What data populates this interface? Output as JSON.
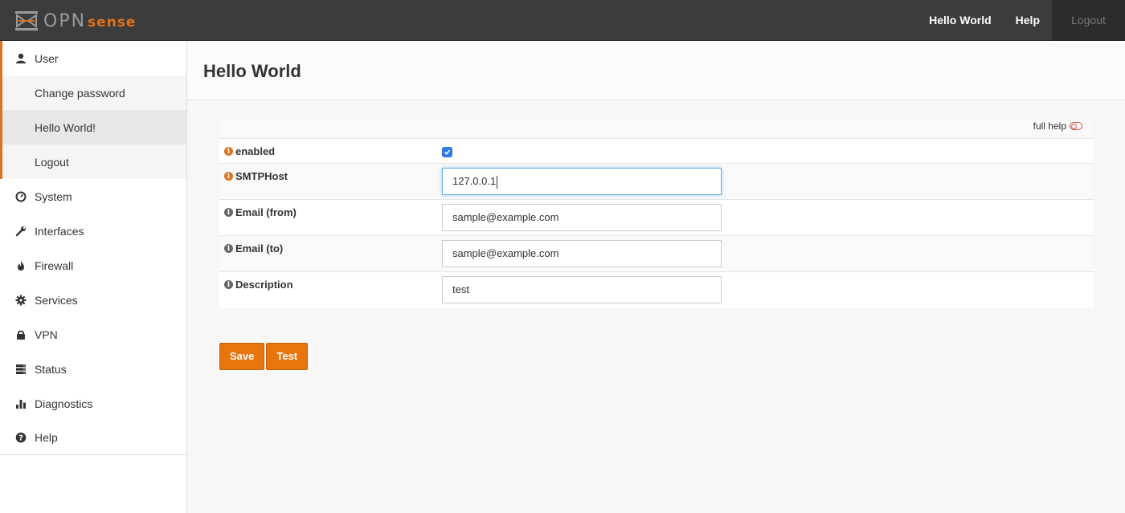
{
  "brand": {
    "name_part1": "OPN",
    "name_part2": "sense"
  },
  "topnav": {
    "item1": "Hello World",
    "item2": "Help",
    "item3": "Logout"
  },
  "sidebar": {
    "user": {
      "label": "User",
      "icon": "user-icon"
    },
    "submenu": [
      {
        "label": "Change password"
      },
      {
        "label": "Hello World!"
      },
      {
        "label": "Logout"
      }
    ],
    "items": [
      {
        "label": "System",
        "icon": "dashboard-icon"
      },
      {
        "label": "Interfaces",
        "icon": "wrench-icon"
      },
      {
        "label": "Firewall",
        "icon": "fire-icon"
      },
      {
        "label": "Services",
        "icon": "gear-icon"
      },
      {
        "label": "VPN",
        "icon": "lock-icon"
      },
      {
        "label": "Status",
        "icon": "server-icon"
      },
      {
        "label": "Diagnostics",
        "icon": "bar-chart-icon"
      },
      {
        "label": "Help",
        "icon": "question-icon"
      }
    ]
  },
  "page": {
    "title": "Hello World"
  },
  "form": {
    "full_help": "full help",
    "enabled": {
      "label": "enabled",
      "checked": true
    },
    "smtphost": {
      "label": "SMTPHost",
      "value": "127.0.0.1"
    },
    "email_from": {
      "label": "Email (from)",
      "value": "sample@example.com"
    },
    "email_to": {
      "label": "Email (to)",
      "value": "sample@example.com"
    },
    "description": {
      "label": "Description",
      "value": "test"
    }
  },
  "buttons": {
    "save": "Save",
    "test": "Test"
  },
  "colors": {
    "accent": "#e0721b",
    "topbar": "#3c3c3c"
  }
}
